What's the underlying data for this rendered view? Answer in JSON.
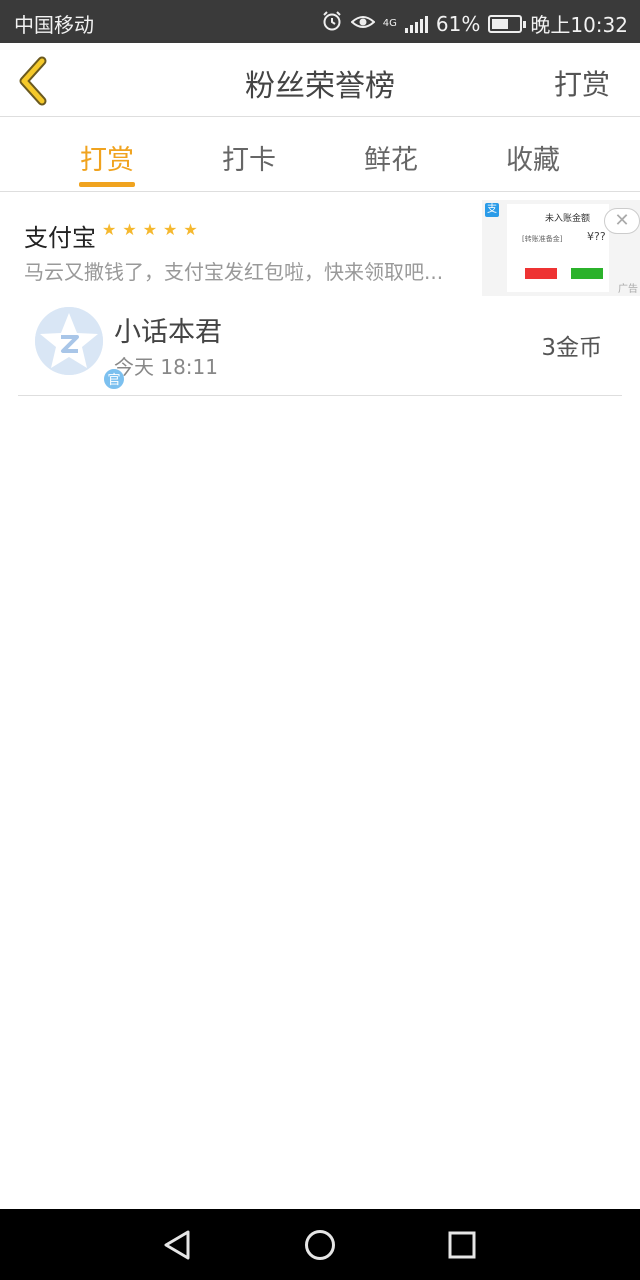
{
  "status_bar": {
    "carrier": "中国移动",
    "network": "4G",
    "battery": "61%",
    "battery_level": 0.61,
    "time": "晚上10:32",
    "icons": [
      "alarm-icon",
      "eye-icon",
      "signal-icon",
      "battery-icon"
    ]
  },
  "header": {
    "title": "粉丝荣誉榜",
    "action_label": "打赏",
    "back_icon": "chevron-left-icon",
    "accent_color": "#f0a31f"
  },
  "tabs": [
    {
      "label": "打赏",
      "active": true
    },
    {
      "label": "打卡",
      "active": false
    },
    {
      "label": "鲜花",
      "active": false
    },
    {
      "label": "收藏",
      "active": false
    }
  ],
  "ad": {
    "title": "支付宝",
    "rating": 5,
    "description": "马云又撒钱了，支付宝发红包啦，快来领取吧...",
    "image": {
      "logo": "支",
      "heading": "未入账金额",
      "field": "[转账准备金]",
      "price": "¥??",
      "label": "广告"
    },
    "close_icon": "close-icon"
  },
  "list": [
    {
      "name": "小话本君",
      "time": "今天 18:11",
      "amount": "3金币",
      "badge": "官"
    }
  ],
  "nav_bar": {
    "icons": [
      "back-triangle-icon",
      "home-circle-icon",
      "recents-square-icon"
    ]
  }
}
